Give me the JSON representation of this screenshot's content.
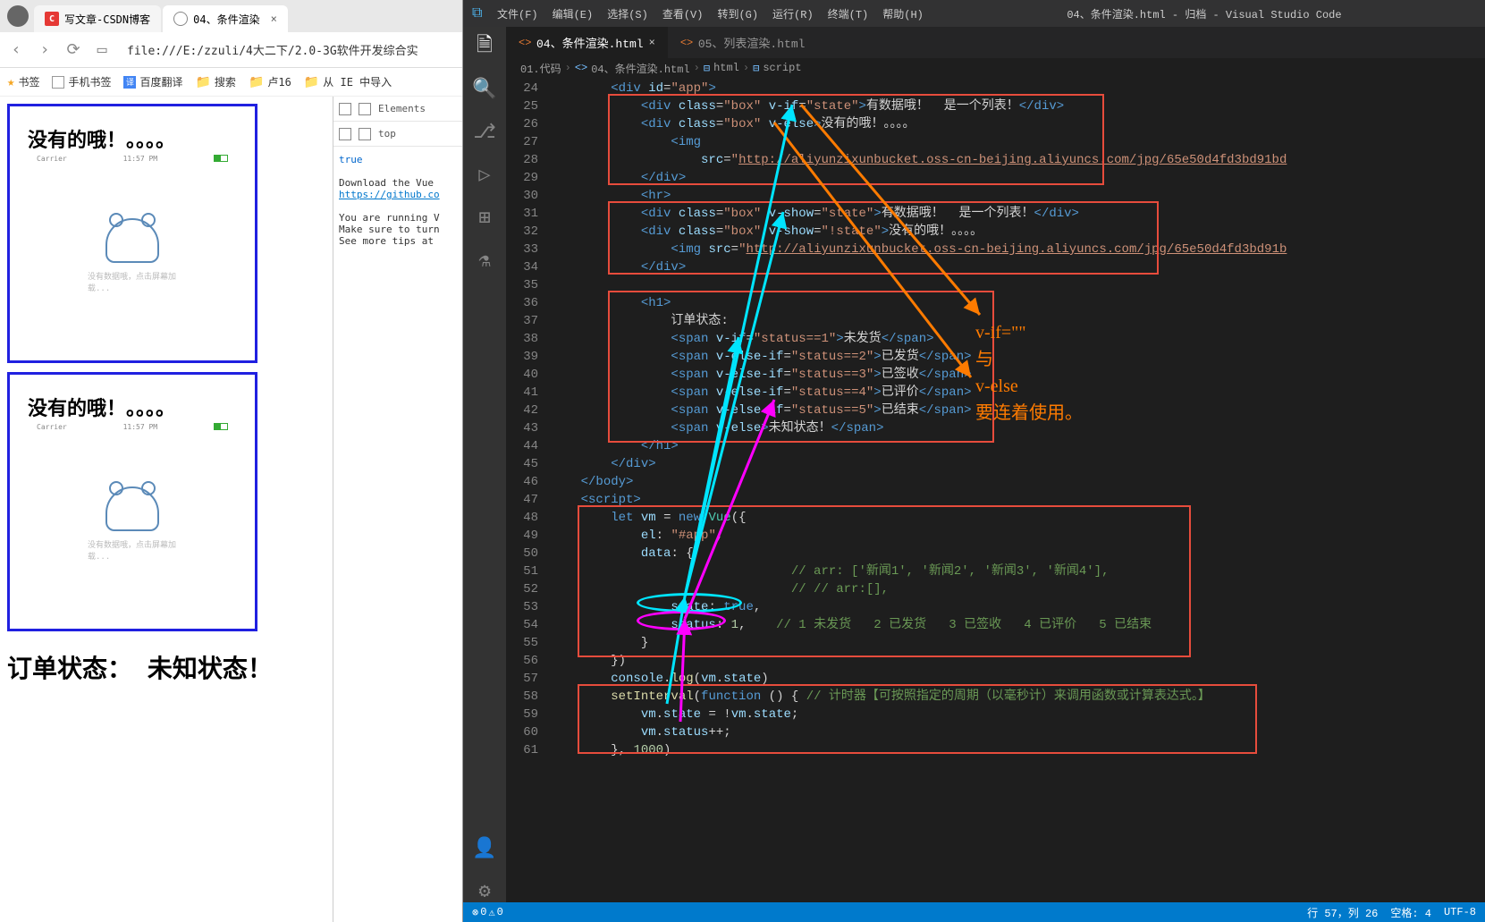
{
  "browser": {
    "tabs": [
      {
        "title": "写文章-CSDN博客"
      },
      {
        "title": "04、条件渲染"
      }
    ],
    "url": "file:///E:/zzuli/4大二下/2.0-3G软件开发综合实",
    "bookmarks": {
      "label": "书签",
      "b1": "手机书签",
      "b2": "百度翻译",
      "b3": "搜索",
      "b4": "卢16",
      "b5": "从 IE 中导入"
    },
    "frame_heading": "没有的哦！。。。。",
    "carrier": "Carrier",
    "time": "11:57 PM",
    "bear_txt": "没有数据哦，点击屏幕加载...",
    "order_heading": "订单状态：  未知状态！",
    "devtools": {
      "tab": "Elements",
      "ctx": "top",
      "true_val": "true",
      "msg1": "Download the Vue",
      "link": "https://github.co",
      "msg2a": "You are running V",
      "msg2b": "Make sure to turn",
      "msg2c": "See more tips at"
    }
  },
  "vscode": {
    "menus": {
      "file": "文件(F)",
      "edit": "编辑(E)",
      "select": "选择(S)",
      "view": "查看(V)",
      "goto": "转到(G)",
      "run": "运行(R)",
      "terminal": "终端(T)",
      "help": "帮助(H)"
    },
    "title": "04、条件渲染.html - 归档 - Visual Studio Code",
    "tabs": {
      "t1": "04、条件渲染.html",
      "t2": "05、列表渲染.html"
    },
    "crumbs": {
      "c1": "01.代码",
      "c2": "04、条件渲染.html",
      "c3": "html",
      "c4": "script"
    },
    "annotation": {
      "l1": "v-if=\"\"",
      "l2": "与",
      "l3": "v-else",
      "l4": "要连着使用。"
    },
    "status": {
      "errs": "0",
      "warns": "0",
      "pos": "行 57，列 26",
      "spaces": "空格: 4",
      "enc": "UTF-8"
    },
    "lines": {
      "l24": "        <div id=\"app\">",
      "l25a": "            <div class=\"box\" v-if=\"state\">",
      "l25b": "有数据哦！  是一个列表！",
      "l25c": "</div>",
      "l26a": "            <div class=\"box\" v-else>",
      "l26b": "没有的哦！。。。。",
      "l27": "                <img",
      "l28a": "                    src=\"",
      "l28b": "http://aliyunzixunbucket.oss-cn-beijing.aliyuncs.com/jpg/65e50d4fd3bd91bd",
      "l29": "            </div>",
      "l30": "            <hr>",
      "l31a": "            <div class=\"box\" v-show=\"state\">",
      "l31b": "有数据哦！  是一个列表！",
      "l31c": "</div>",
      "l32a": "            <div class=\"box\" v-show=\"!state\">",
      "l32b": "没有的哦！。。。。",
      "l33a": "                <img src=\"",
      "l33b": "http://aliyunzixunbucket.oss-cn-beijing.aliyuncs.com/jpg/65e50d4fd3bd91b",
      "l34": "            </div>",
      "l35": "",
      "l36": "            <h1>",
      "l37": "                订单状态:",
      "l38a": "                <span v-if=\"status==1\">",
      "l38b": "未发货",
      "l38c": "</span>",
      "l39a": "                <span v-else-if=\"status==2\">",
      "l39b": "已发货",
      "l39c": "</span>",
      "l40a": "                <span v-else-if=\"status==3\">",
      "l40b": "已签收",
      "l40c": "</span>",
      "l41a": "                <span v-else-if=\"status==4\">",
      "l41b": "已评价",
      "l41c": "</span>",
      "l42a": "                <span v-else-if=\"status==5\">",
      "l42b": "已结束",
      "l42c": "</span>",
      "l43a": "                <span v-else>",
      "l43b": "未知状态！",
      "l43c": "</span>",
      "l44": "            </h1>",
      "l45": "        </div>",
      "l46": "    </body>",
      "l47": "    <script>",
      "l48": "        let vm = new Vue({",
      "l49": "            el: \"#app\",",
      "l50": "            data: {",
      "l51": "                // arr: ['新闻1', '新闻2', '新闻3', '新闻4'],",
      "l52": "                // // arr:[],",
      "l53": "                state: true,",
      "l54a": "                status: 1,",
      "l54b": "    // 1 未发货   2 已发货   3 已签收   4 已评价   5 已结束",
      "l55": "            }",
      "l56": "        })",
      "l57": "        console.log(vm.state)",
      "l58a": "        setInterval(function () { ",
      "l58b": "// 计时器【可按照指定的周期（以毫秒计）来调用函数或计算表达式。】",
      "l59": "            vm.state = !vm.state;",
      "l60": "            vm.status++;",
      "l61": "        }, 1000)"
    }
  }
}
